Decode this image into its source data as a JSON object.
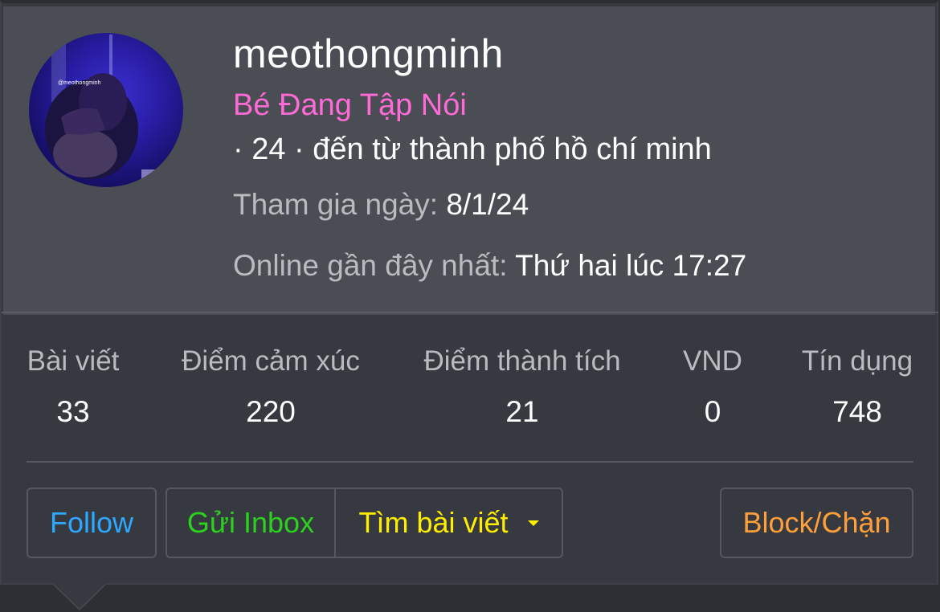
{
  "profile": {
    "username": "meothongminh",
    "avatar_watermark": "@meothongminh",
    "user_title": "Bé Đang Tập Nói",
    "meta": "· 24 · đến từ thành phố hồ chí minh",
    "joined_label": "Tham gia ngày:",
    "joined_value": "8/1/24",
    "lastseen_label": "Online gần đây nhất:",
    "lastseen_value": "Thứ hai lúc 17:27"
  },
  "stats": [
    {
      "label": "Bài viết",
      "value": "33"
    },
    {
      "label": "Điểm cảm xúc",
      "value": "220"
    },
    {
      "label": "Điểm thành tích",
      "value": "21"
    },
    {
      "label": "VND",
      "value": "0"
    },
    {
      "label": "Tín dụng",
      "value": "748"
    }
  ],
  "actions": {
    "follow": "Follow",
    "inbox": "Gửi Inbox",
    "search": "Tìm bài viết",
    "block": "Block/Chặn"
  },
  "colors": {
    "title": "#ff6bd6",
    "follow": "#2ea8ff",
    "inbox": "#2cd11f",
    "search": "#ffee00",
    "block": "#ff9f3a"
  }
}
